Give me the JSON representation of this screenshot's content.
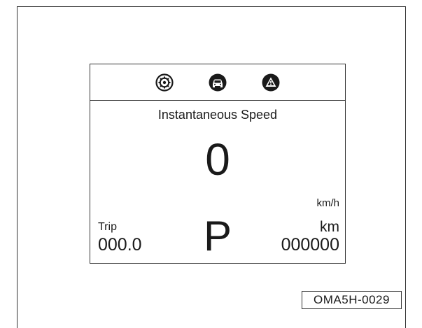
{
  "display": {
    "icons": [
      "gear-circle-icon",
      "car-circle-icon",
      "warning-triangle-icon"
    ],
    "speed_label": "Instantaneous Speed",
    "speed_value": "0",
    "speed_unit": "km/h",
    "trip_label": "Trip",
    "trip_value": "000.0",
    "gear_position": "P",
    "odometer_unit": "km",
    "odometer_value": "000000"
  },
  "figure_code": "OMA5H-0029"
}
